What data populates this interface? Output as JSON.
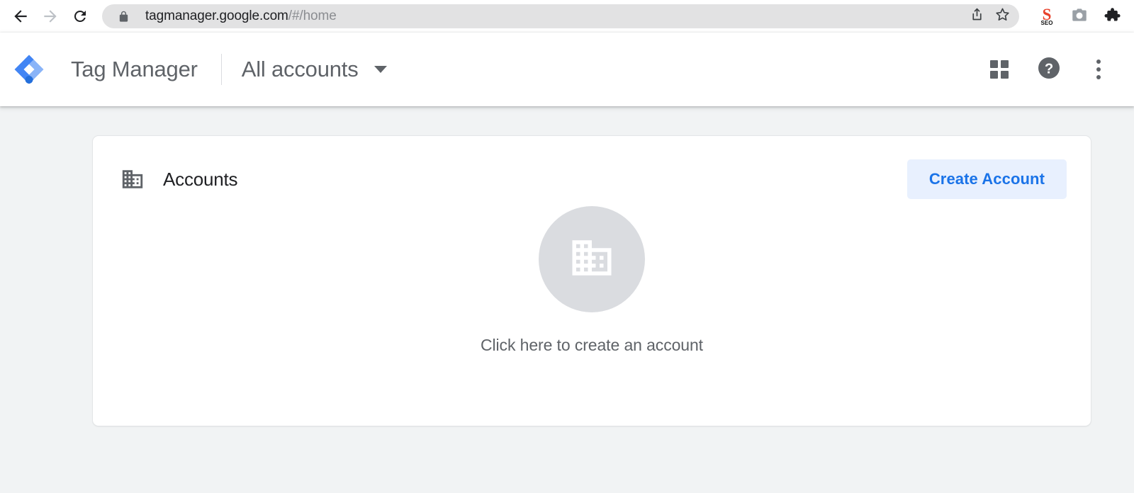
{
  "browser": {
    "back_icon": "arrow-left-icon",
    "forward_icon": "arrow-right-icon",
    "reload_icon": "reload-icon",
    "lock_icon": "lock-icon",
    "url_domain": "tagmanager.google.com",
    "url_path": "/#/home",
    "url_full": "tagmanager.google.com/#/home",
    "share_icon": "share-icon",
    "bookmark_icon": "star-outline-icon",
    "extensions": [
      {
        "name": "seo-extension-icon",
        "label": "SEO",
        "color": "#e8412b"
      },
      {
        "name": "camera-extension-icon",
        "label": "",
        "color": "#9aa0a6"
      },
      {
        "name": "puzzle-extensions-icon",
        "label": "",
        "color": "#202124"
      }
    ]
  },
  "app_header": {
    "logo_icon": "tag-manager-logo-icon",
    "product_title": "Tag Manager",
    "account_selector_label": "All accounts",
    "caret_icon": "chevron-down-icon",
    "apps_icon": "apps-grid-icon",
    "help_icon": "help-circle-icon",
    "more_icon": "more-vertical-icon"
  },
  "accounts_card": {
    "icon": "building-icon",
    "title": "Accounts",
    "create_button_label": "Create Account",
    "empty_state": {
      "icon": "building-icon",
      "message": "Click here to create an account"
    }
  },
  "colors": {
    "accent_blue": "#1a73e8",
    "button_bg": "#e8f0fe",
    "page_bg": "#f1f3f4",
    "card_bg": "#ffffff",
    "text_secondary": "#5f6368",
    "empty_circle": "#dadce0"
  }
}
